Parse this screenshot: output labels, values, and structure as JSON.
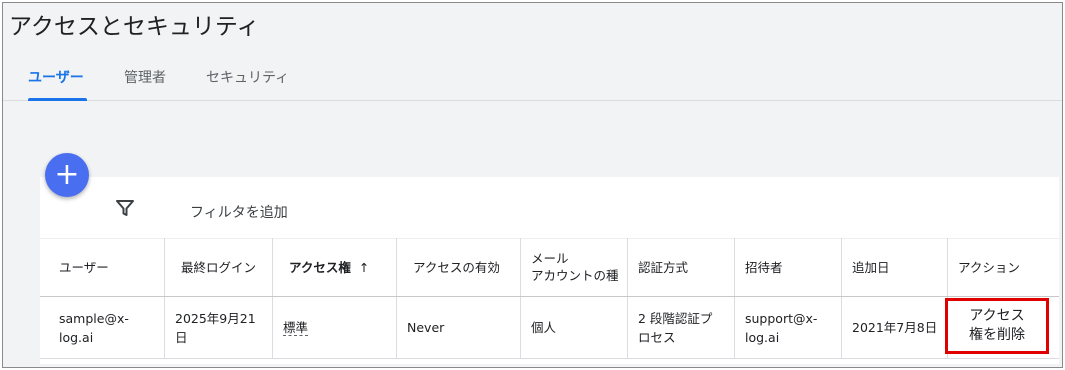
{
  "page": {
    "title": "アクセスとセキュリティ"
  },
  "tabs": [
    {
      "label": "ユーザー",
      "active": true
    },
    {
      "label": "管理者",
      "active": false
    },
    {
      "label": "セキュリティ",
      "active": false
    }
  ],
  "toolbar": {
    "add_button_label": "+",
    "add_button_icon": "plus-icon",
    "filter_icon": "filter-icon",
    "filter_label": "フィルタを追加"
  },
  "table": {
    "columns": [
      {
        "label": "ユーザー"
      },
      {
        "label": "最終ログイン"
      },
      {
        "label": "アクセス権",
        "sorted": "ascending",
        "sort_icon": "↑"
      },
      {
        "label": "アクセスの有効"
      },
      {
        "label": "メール アカウントの種"
      },
      {
        "label": "認証方式"
      },
      {
        "label": "招待者"
      },
      {
        "label": "追加日"
      },
      {
        "label": "アクション"
      }
    ],
    "column_labels": {
      "user": "ユーザー",
      "last_login": "最終ログイン",
      "access": "アクセス権",
      "access_sort_icon": "↑",
      "access_valid": "アクセスの有効",
      "email_line1": "メール",
      "email_line2": "アカウントの種",
      "auth": "認証方式",
      "inviter": "招待者",
      "added": "追加日",
      "action": "アクション"
    },
    "rows": [
      {
        "user_line1": "sample@x-",
        "user_line2": "log.ai",
        "last_login_line1": "2025年9月21",
        "last_login_line2": "日",
        "access": "標準",
        "access_valid": "Never",
        "email_type": "個人",
        "auth_line1": "2 段階認証プ",
        "auth_line2": "ロセス",
        "inviter_line1": "support@x-",
        "inviter_line2": "log.ai",
        "added": "2021年7月8日",
        "action_line1": "アクセス",
        "action_line2": "権を削除"
      }
    ]
  },
  "colors": {
    "accent": "#1a73e8",
    "fab": "#4a6ef0",
    "highlight_border": "#e00000",
    "background": "#f1f3f4"
  }
}
